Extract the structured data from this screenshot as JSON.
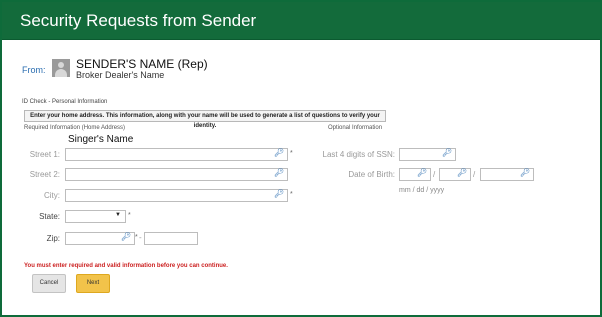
{
  "header": {
    "title": "Security Requests from Sender"
  },
  "from": {
    "label": "From:",
    "sender_name": "SENDER'S NAME (Rep)",
    "sender_role": "Broker Dealer's Name"
  },
  "section": {
    "label": "ID Check - Personal Information",
    "notice": "Enter your home address. This information, along with your name will be used to generate a list of questions to verify your identity.",
    "required_label": "Required Information (Home Address)",
    "optional_label": "Optional Information",
    "signer_name": "Singer's Name"
  },
  "fields": {
    "street1": {
      "label": "Street 1:",
      "value": ""
    },
    "street2": {
      "label": "Street 2:",
      "value": ""
    },
    "city": {
      "label": "City:",
      "value": ""
    },
    "state": {
      "label": "State:",
      "value": ""
    },
    "zip": {
      "label": "Zip:",
      "value": "",
      "ext_value": ""
    },
    "ssn": {
      "label": "Last 4 digits of SSN:",
      "value": ""
    },
    "dob": {
      "label": "Date of Birth:",
      "mm": "",
      "dd": "",
      "yyyy": "",
      "hint": "mm / dd / yyyy",
      "separator": "/"
    }
  },
  "required_marker": "*",
  "zip_separator": "-",
  "icons": {
    "field_key": "key-icon",
    "caret": "chevron-down-icon",
    "avatar": "user-silhouette-icon"
  },
  "error": "You must enter required and valid information before you can continue.",
  "buttons": {
    "cancel": "Cancel",
    "next": "Next"
  },
  "colors": {
    "header_bg": "#136b3b",
    "link": "#2a6db0",
    "error": "#cc2222",
    "next_button": "#f2c34a"
  }
}
